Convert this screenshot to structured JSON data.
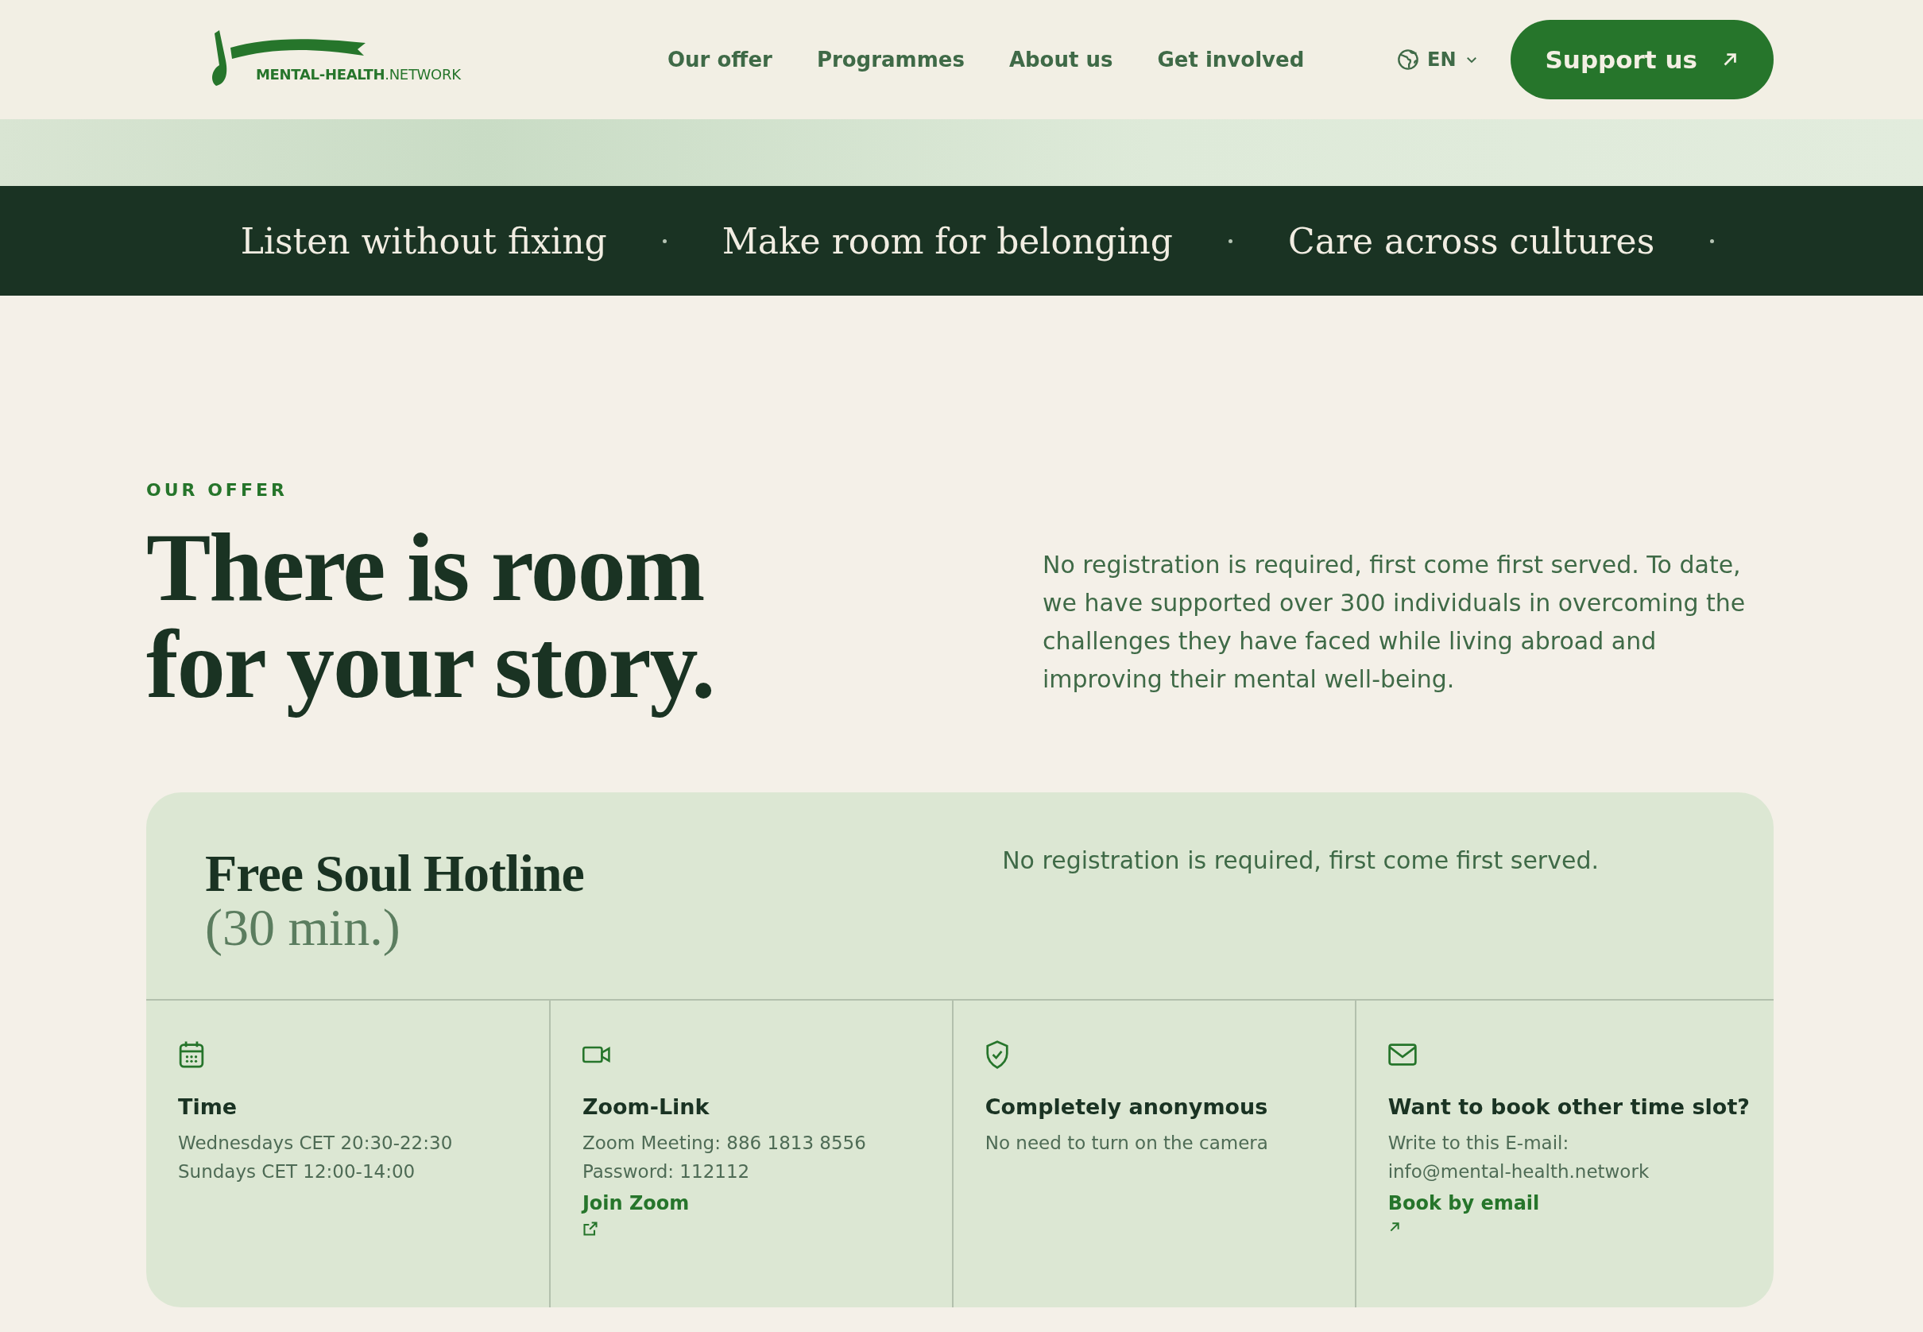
{
  "header": {
    "logo": "**MENTAL-HEALTH**.NETWORK",
    "nav": [
      "Our offer",
      "Programmes",
      "About us",
      "Get involved"
    ],
    "language": "EN",
    "cta": "Support us"
  },
  "ticker": [
    "Listen without fixing",
    "Make room for belonging",
    "Care across cultures"
  ],
  "offer": {
    "eyebrow": "OUR OFFER",
    "title_lines": [
      "There is room",
      "for your story."
    ],
    "intro": "No registration is required, first come first served. To date, we have supported over 300 individuals in overcoming the challenges they have faced while living abroad and improving their mental well-being."
  },
  "hotline": {
    "title": "Free Soul Hotline",
    "subtitle": "(30 min.)",
    "note": "No registration is required, first come first served.",
    "cells": [
      {
        "kind": "calendar",
        "title": "Time",
        "lines": [
          "Wednesdays CET 20:30-22:30",
          "Sundays CET 12:00-14:00"
        ]
      },
      {
        "kind": "video",
        "title": "Zoom-Link",
        "lines": [
          "Zoom Meeting: 886 1813 8556",
          "Password: 112112"
        ],
        "link": {
          "label": "Join Zoom",
          "kind": "external"
        }
      },
      {
        "kind": "shield",
        "title": "Completely anonymous",
        "lines": [
          "No need to turn on the camera"
        ]
      },
      {
        "kind": "mail",
        "title": "Want to book other time slot?",
        "lines": [
          "Write to this E-mail:",
          "info@mental-health.network"
        ],
        "link": {
          "label": "Book by email",
          "kind": "arrow"
        }
      }
    ]
  }
}
